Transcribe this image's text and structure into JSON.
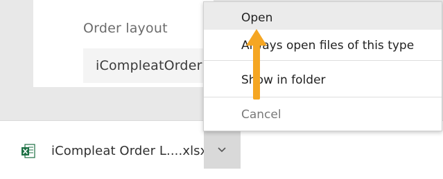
{
  "form": {
    "order_layout_label": "Order layout",
    "order_layout_value": "iCompleatOrder"
  },
  "download": {
    "file_name": "iCompleat Order L....xlsx",
    "file_icon": "excel-file-icon",
    "chevron_icon": "chevron-down-icon"
  },
  "context_menu": {
    "items": [
      {
        "label": "Open",
        "highlighted": true
      },
      {
        "label": "Always open files of this type"
      },
      {
        "label": "Show in folder"
      },
      {
        "label": "Cancel",
        "disabled": true
      }
    ]
  },
  "annotation": {
    "arrow_color": "#f5a623",
    "arrow_icon": "up-arrow-annotation"
  },
  "colors": {
    "backdrop": "#e8e8e8",
    "excel_green": "#1d7044"
  }
}
